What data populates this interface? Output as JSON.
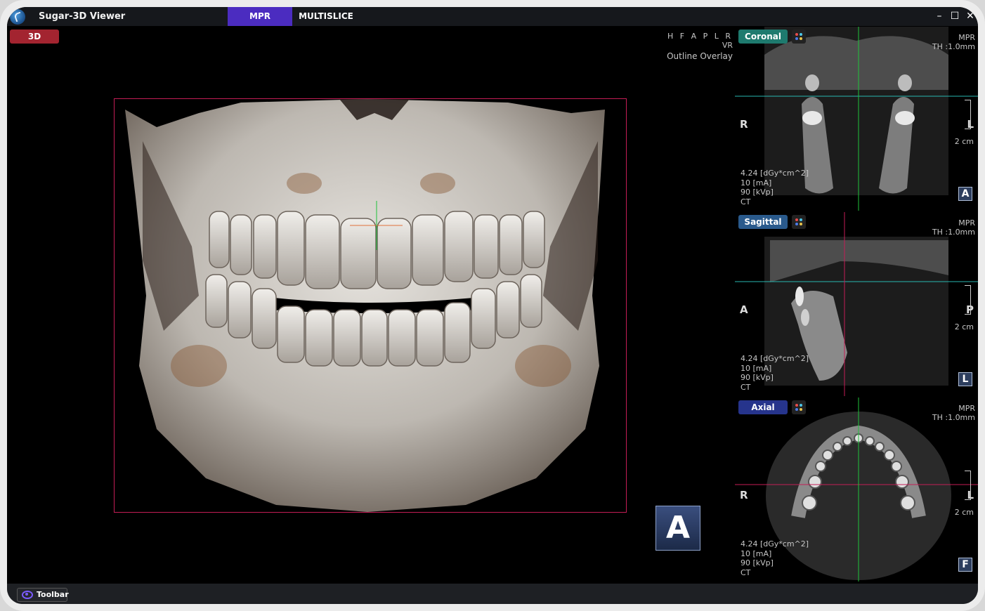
{
  "app": {
    "title": "Sugar-3D Viewer"
  },
  "tabs": [
    {
      "label": "MPR",
      "active": true
    },
    {
      "label": "MULTISLICE",
      "active": false
    }
  ],
  "window_controls": {
    "minimize": "–",
    "maximize": "☐",
    "close": "✕"
  },
  "main_view": {
    "mode_button": "3D",
    "orientation_letters": "H F A P L R",
    "render_mode": "VR",
    "overlay_label": "Outline Overlay",
    "orientation_cube": "A"
  },
  "panels": [
    {
      "name": "Coronal",
      "color": "#1e7a6e",
      "mpr": "MPR",
      "thickness": "TH :1.0mm",
      "left_letter": "R",
      "right_letter": "L",
      "scale": "2 cm",
      "dose": "4.24  [dGy*cm^2]",
      "ma": "10 [mA]",
      "kvp": "90 [kVp]",
      "modality": "CT",
      "badge": "A"
    },
    {
      "name": "Sagittal",
      "color": "#2a5a8c",
      "mpr": "MPR",
      "thickness": "TH :1.0mm",
      "left_letter": "A",
      "right_letter": "P",
      "scale": "2 cm",
      "dose": "4.24  [dGy*cm^2]",
      "ma": "10 [mA]",
      "kvp": "90 [kVp]",
      "modality": "CT",
      "badge": "L"
    },
    {
      "name": "Axial",
      "color": "#26348c",
      "mpr": "MPR",
      "thickness": "TH :1.0mm",
      "left_letter": "R",
      "right_letter": "L",
      "scale": "2 cm",
      "dose": "4.24  [dGy*cm^2]",
      "ma": "10 [mA]",
      "kvp": "90 [kVp]",
      "modality": "CT",
      "badge": "F"
    }
  ],
  "statusbar": {
    "toolbar_label": "Toolbar"
  },
  "colors": {
    "accent": "#4b2cc0",
    "button_3d": "#a32430",
    "crosshair_green": "#1fc23a",
    "crosshair_cyan": "#27b6b0",
    "crosshair_magenta": "#c41d56"
  }
}
